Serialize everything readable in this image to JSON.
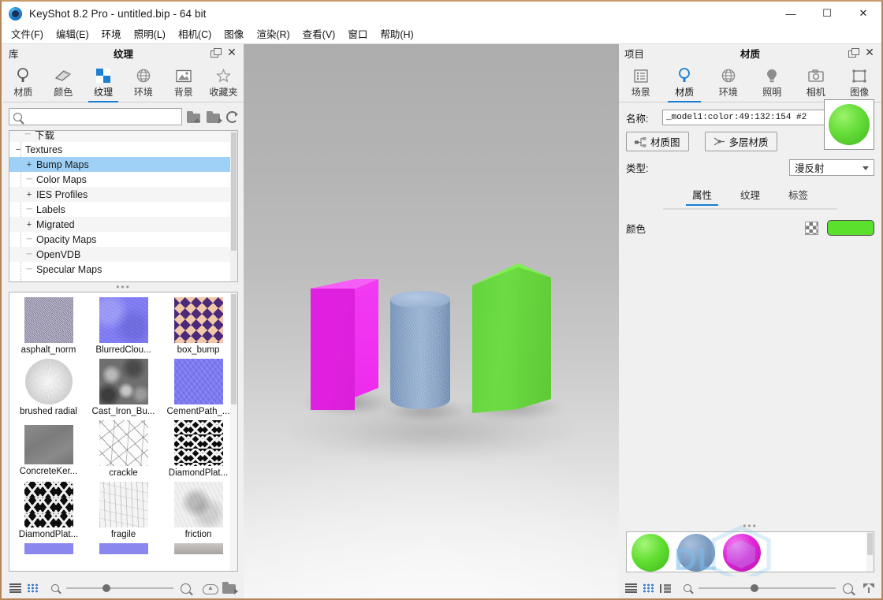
{
  "window": {
    "title": "KeyShot 8.2 Pro  - untitled.bip  - 64 bit",
    "minimize": "—",
    "maximize": "☐",
    "close": "✕"
  },
  "menu": {
    "items": [
      {
        "label": "文件(F)"
      },
      {
        "label": "编辑(E)"
      },
      {
        "label": "环境"
      },
      {
        "label": "照明(L)"
      },
      {
        "label": "相机(C)"
      },
      {
        "label": "图像"
      },
      {
        "label": "渲染(R)"
      },
      {
        "label": "查看(V)"
      },
      {
        "label": "窗口"
      },
      {
        "label": "帮助(H)"
      }
    ]
  },
  "library": {
    "header": {
      "left_label": "库",
      "title": "纹理"
    },
    "tabs": [
      {
        "label": "材质",
        "icon": "material-icon",
        "active": false
      },
      {
        "label": "颜色",
        "icon": "color-icon",
        "active": false
      },
      {
        "label": "纹理",
        "icon": "texture-icon",
        "active": true
      },
      {
        "label": "环境",
        "icon": "environment-icon",
        "active": false
      },
      {
        "label": "背景",
        "icon": "backplate-icon",
        "active": false
      },
      {
        "label": "收藏夹",
        "icon": "favorites-star-icon",
        "active": false
      }
    ],
    "search": {
      "value": "",
      "placeholder": ""
    },
    "tree": [
      {
        "label": "下载",
        "expander": "dash",
        "indent": 1,
        "selected": false
      },
      {
        "label": "Textures",
        "expander": "minus",
        "indent": 0,
        "selected": false
      },
      {
        "label": "Bump Maps",
        "expander": "plus",
        "indent": 1,
        "selected": true
      },
      {
        "label": "Color Maps",
        "expander": "dash",
        "indent": 1,
        "selected": false
      },
      {
        "label": "IES Profiles",
        "expander": "plus",
        "indent": 1,
        "selected": false
      },
      {
        "label": "Labels",
        "expander": "dash",
        "indent": 1,
        "selected": false
      },
      {
        "label": "Migrated",
        "expander": "plus",
        "indent": 1,
        "selected": false
      },
      {
        "label": "Opacity Maps",
        "expander": "dash",
        "indent": 1,
        "selected": false
      },
      {
        "label": "OpenVDB",
        "expander": "dash",
        "indent": 1,
        "selected": false
      },
      {
        "label": "Specular Maps",
        "expander": "dash",
        "indent": 1,
        "selected": false
      }
    ],
    "thumbnails": [
      {
        "label": "asphalt_norm",
        "tex": "tx-asphalt"
      },
      {
        "label": "BlurredClou...",
        "tex": "tx-bluecloud"
      },
      {
        "label": "box_bump",
        "tex": "tx-box"
      },
      {
        "label": "brushed radial",
        "tex": "tx-brushed"
      },
      {
        "label": "Cast_Iron_Bu...",
        "tex": "tx-castiron"
      },
      {
        "label": "CementPath_...",
        "tex": "tx-cement"
      },
      {
        "label": "ConcreteKer...",
        "tex": "tx-concrete"
      },
      {
        "label": "crackle",
        "tex": "tx-crackle"
      },
      {
        "label": "DiamondPlat...",
        "tex": "tx-diamond1"
      },
      {
        "label": "DiamondPlat...",
        "tex": "tx-diamond2"
      },
      {
        "label": "fragile",
        "tex": "tx-fragile"
      },
      {
        "label": "friction",
        "tex": "tx-friction"
      }
    ],
    "bottom": {
      "list_view": "list-view-icon",
      "grid_view": "grid-view-icon",
      "zoom_out": "zoom-out-icon",
      "zoom_in": "zoom-in-icon",
      "slider_value": "35",
      "upload": "cloud-upload-icon",
      "open_folder": "open-folder-icon"
    }
  },
  "project": {
    "header": {
      "left_label": "项目",
      "title": "材质"
    },
    "tabs": [
      {
        "label": "场景",
        "icon": "scene-list-icon",
        "active": false
      },
      {
        "label": "材质",
        "icon": "material-icon",
        "active": true
      },
      {
        "label": "环境",
        "icon": "environment-icon",
        "active": false
      },
      {
        "label": "照明",
        "icon": "lighting-bulb-icon",
        "active": false
      },
      {
        "label": "相机",
        "icon": "camera-icon",
        "active": false
      },
      {
        "label": "图像",
        "icon": "image-frame-icon",
        "active": false
      }
    ],
    "name_label": "名称:",
    "name_value": "_model1:color:49:132:154 #2",
    "save_icon": "save-disk-icon",
    "buttons": {
      "material_graph": "材质图",
      "multi_layer": "多层材质"
    },
    "type_label": "类型:",
    "type_value": "漫反射",
    "type_options": [
      "漫反射"
    ],
    "subtabs": [
      {
        "label": "属性",
        "active": true
      },
      {
        "label": "纹理",
        "active": false
      },
      {
        "label": "标签",
        "active": false
      }
    ],
    "color_label": "颜色",
    "color_value": "#5ce02e",
    "preview_ball_color": "#63df33",
    "material_strip": [
      {
        "name": "green-material",
        "cls": "mat-green"
      },
      {
        "name": "blue-material",
        "cls": "mat-blue"
      },
      {
        "name": "magenta-material",
        "cls": "mat-mag"
      }
    ],
    "bottom": {
      "list_view": "list-view-icon",
      "grid_view": "grid-view-icon",
      "tree_view": "tree-view-icon",
      "zoom_out": "zoom-out-icon",
      "zoom_in": "zoom-in-icon",
      "filter": "filter-funnel-icon"
    },
    "watermark": "DL"
  },
  "viewport": {
    "objects": [
      {
        "name": "magenta-box",
        "color": "#df21df"
      },
      {
        "name": "blue-cylinder",
        "color": "#8aa7cd"
      },
      {
        "name": "green-prism",
        "color": "#6ad83f"
      }
    ]
  }
}
